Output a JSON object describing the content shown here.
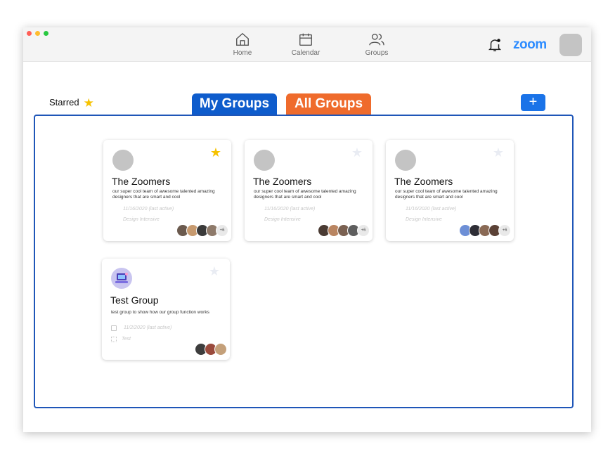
{
  "nav": {
    "home": "Home",
    "calendar": "Calendar",
    "groups": "Groups"
  },
  "brand": "zoom",
  "starred_label": "Starred",
  "tabs": {
    "my_groups": "My Groups",
    "all_groups": "All Groups"
  },
  "add_button": "+",
  "cards": [
    {
      "name": "The Zoomers",
      "description": "our super cool team of awesome talented amazing designers that are smart and cool",
      "date": "11/16/2020 (last active)",
      "tag": "Design Intensive",
      "more": "+6",
      "starred": true
    },
    {
      "name": "The Zoomers",
      "description": "our super cool team of awesome talented amazing designers that are smart and cool",
      "date": "11/16/2020 (last active)",
      "tag": "Design Intensive",
      "more": "+6",
      "starred": false
    },
    {
      "name": "The Zoomers",
      "description": "our super cool team of awesome talented amazing designers that are smart and cool",
      "date": "11/16/2020 (last active)",
      "tag": "Design Intensive",
      "more": "+6",
      "starred": false
    },
    {
      "name": "Test Group",
      "description": "test group to show how our group function works",
      "date": "11/2/2020 (last active)",
      "tag": "Test",
      "starred": false
    }
  ],
  "colors": {
    "brand_blue": "#2d8cff",
    "my_groups_tab": "#0e5ccc",
    "all_groups_tab": "#ef6b2c",
    "panel_border": "#1f56b8",
    "star_active": "#f6c200"
  }
}
